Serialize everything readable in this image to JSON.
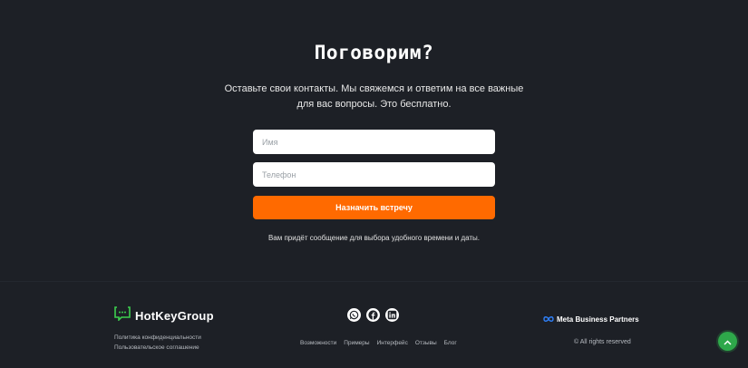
{
  "contact": {
    "title": "Поговорим?",
    "subtitle": "Оставьте свои контакты. Мы свяжемся и ответим на все важные для вас вопросы. Это бесплатно.",
    "name_placeholder": "Имя",
    "phone_placeholder": "Телефон",
    "submit_label": "Назначить встречу",
    "note": "Вам придёт сообщение для выбора удобного времени и даты."
  },
  "footer": {
    "brand_first": "HotKey",
    "brand_second": "Group",
    "privacy_link": "Политика конфиденциальности",
    "terms_link": "Пользовательское соглашение",
    "socials": [
      {
        "icon": "whatsapp-icon"
      },
      {
        "icon": "facebook-icon"
      },
      {
        "icon": "linkedin-icon"
      }
    ],
    "nav": [
      "Возможности",
      "Примеры",
      "Интерфейс",
      "Отзывы",
      "Блог"
    ],
    "partner": "Meta Business Partners",
    "copyright": "© All rights reserved"
  },
  "colors": {
    "background": "#1d2026",
    "accent": "#ff6a00",
    "brand_green": "#3ccf4e",
    "scroll_button": "#2ea84a"
  }
}
